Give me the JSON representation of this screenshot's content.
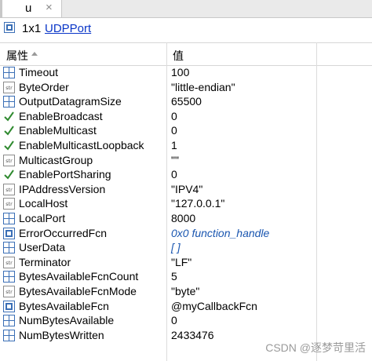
{
  "tab": {
    "label": "u",
    "close_symbol": "×"
  },
  "object": {
    "size": "1x1",
    "class_link": "UDPPort"
  },
  "columns": {
    "property": "属性",
    "value": "值"
  },
  "rows": [
    {
      "name": "Timeout",
      "value": "100",
      "icon": "numeric-grid-icon"
    },
    {
      "name": "ByteOrder",
      "value": "\"little-endian\"",
      "icon": "string-icon"
    },
    {
      "name": "OutputDatagramSize",
      "value": "65500",
      "icon": "numeric-grid-icon"
    },
    {
      "name": "EnableBroadcast",
      "value": "0",
      "icon": "logical-check-icon"
    },
    {
      "name": "EnableMulticast",
      "value": "0",
      "icon": "logical-check-icon"
    },
    {
      "name": "EnableMulticastLoopback",
      "value": "1",
      "icon": "logical-check-icon"
    },
    {
      "name": "MulticastGroup",
      "value": "\"\"",
      "icon": "string-icon"
    },
    {
      "name": "EnablePortSharing",
      "value": "0",
      "icon": "logical-check-icon"
    },
    {
      "name": "IPAddressVersion",
      "value": "\"IPV4\"",
      "icon": "string-icon"
    },
    {
      "name": "LocalHost",
      "value": "\"127.0.0.1\"",
      "icon": "string-icon"
    },
    {
      "name": "LocalPort",
      "value": "8000",
      "icon": "numeric-grid-icon"
    },
    {
      "name": "ErrorOccurredFcn",
      "value": "0x0 function_handle",
      "icon": "function-handle-icon"
    },
    {
      "name": "UserData",
      "value": "[ ]",
      "icon": "numeric-grid-icon"
    },
    {
      "name": "Terminator",
      "value": "\"LF\"",
      "icon": "string-icon"
    },
    {
      "name": "BytesAvailableFcnCount",
      "value": "5",
      "icon": "numeric-grid-icon"
    },
    {
      "name": "BytesAvailableFcnMode",
      "value": "\"byte\"",
      "icon": "string-icon"
    },
    {
      "name": "BytesAvailableFcn",
      "value": "@myCallbackFcn",
      "icon": "function-handle-icon"
    },
    {
      "name": "NumBytesAvailable",
      "value": "0",
      "icon": "numeric-grid-icon"
    },
    {
      "name": "NumBytesWritten",
      "value": "2433476",
      "icon": "numeric-grid-icon"
    }
  ],
  "watermark": "CSDN @逐梦苛里活",
  "colors": {
    "link": "#0a36c8",
    "function_value": "#1a56b0",
    "icon_blue": "#3b6fb6",
    "check_green": "#2f8a2f"
  }
}
